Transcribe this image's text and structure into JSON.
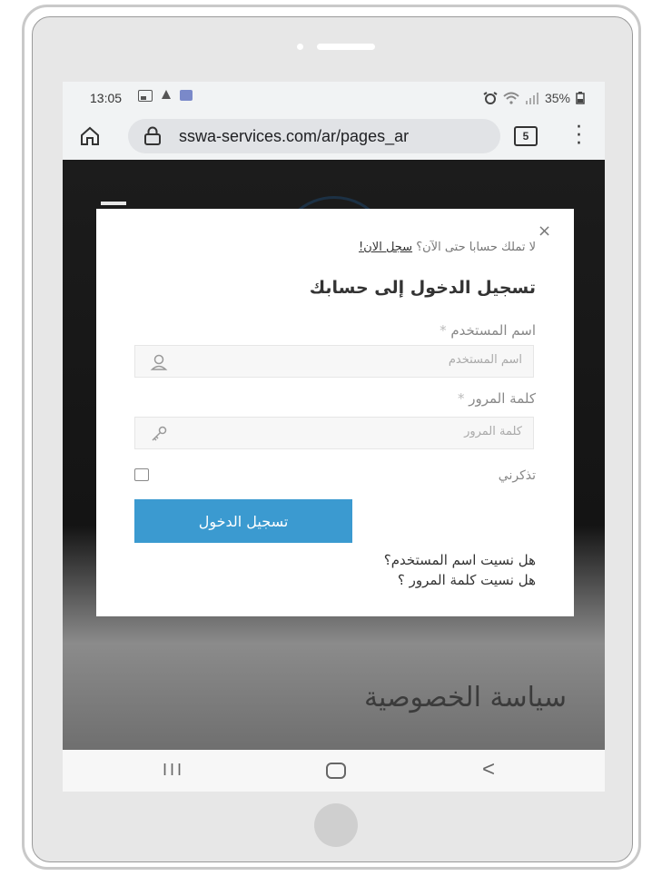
{
  "status_bar": {
    "time": "13:05",
    "battery": "35%",
    "icons": [
      "gallery-icon",
      "notification-icon",
      "message-icon",
      "alarm-icon",
      "wifi-icon",
      "signal-icon",
      "battery-icon"
    ]
  },
  "browser": {
    "url": "sswa-services.com/ar/pages_ar",
    "tab_count": "5"
  },
  "page": {
    "heading": "سياسة الخصوصية"
  },
  "modal": {
    "signup_prompt": "لا تملك حسابا حتى الآن؟",
    "signup_link": "سجل الان!",
    "title": "تسجيل الدخول إلى حسابك",
    "username_label": "اسم المستخدم",
    "username_placeholder": "اسم المستخدم",
    "password_label": "كلمة المرور",
    "password_placeholder": "كلمة المرور",
    "required_mark": "*",
    "remember_me": "تذكرني",
    "login_button": "تسجيل الدخول",
    "forgot_username": "هل نسيت اسم المستخدم؟",
    "forgot_password": "هل نسيت كلمة المرور ؟",
    "close_symbol": "×"
  },
  "nav": {
    "recent": "III",
    "back": "<"
  },
  "colors": {
    "accent": "#3b9ad0",
    "page_dark": "#1c1c1c"
  }
}
